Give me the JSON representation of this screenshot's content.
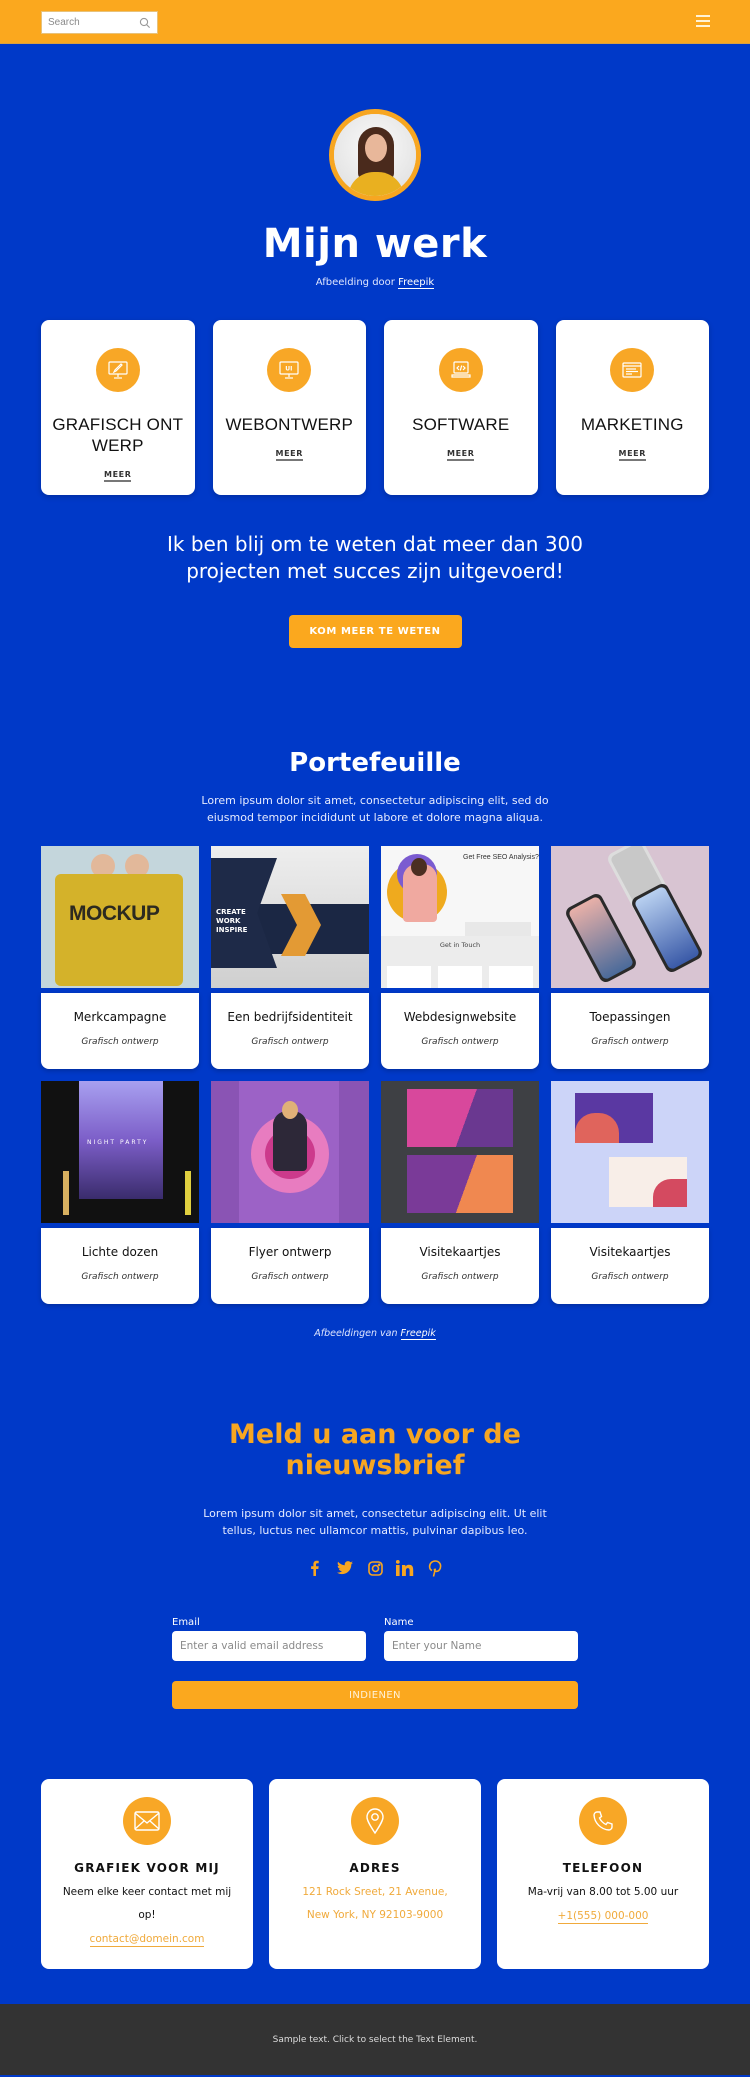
{
  "header": {
    "search_placeholder": "Search",
    "menu_icon": "hamburger-icon"
  },
  "hero": {
    "avatar_alt": "Portrait of smiling woman",
    "title": "Mijn werk",
    "credit_prefix": "Afbeelding door ",
    "credit_link": "Freepik"
  },
  "services": [
    {
      "icon": "graphic-design-monitor-icon",
      "title": "GRAFISCH ONTWERP",
      "link": "MEER"
    },
    {
      "icon": "ui-monitor-icon",
      "title": "WEBONTWERP",
      "link": "MEER"
    },
    {
      "icon": "code-laptop-icon",
      "title": "SOFTWARE",
      "link": "MEER"
    },
    {
      "icon": "browser-window-icon",
      "title": "MARKETING",
      "link": "MEER"
    }
  ],
  "tagline": "Ik ben blij om te weten dat meer dan 300 projecten met succes zijn uitgevoerd!",
  "cta_label": "KOM MEER TE WETEN",
  "portfolio": {
    "title": "Portefeuille",
    "lead": "Lorem ipsum dolor sit amet, consectetur adipiscing elit, sed do eiusmod tempor incididunt ut labore et dolore magna aliqua.",
    "items": [
      {
        "title": "Merkcampagne",
        "category": "Grafisch ontwerp",
        "image": "yellow mockup bag"
      },
      {
        "title": "Een bedrijfsidentiteit",
        "category": "Grafisch ontwerp",
        "image": "corporate template brochure"
      },
      {
        "title": "Webdesignwebsite",
        "category": "Grafisch ontwerp",
        "image": "SEO landing page"
      },
      {
        "title": "Toepassingen",
        "category": "Grafisch ontwerp",
        "image": "phone mockups"
      },
      {
        "title": "Lichte dozen",
        "category": "Grafisch ontwerp",
        "image": "night party lightbox poster"
      },
      {
        "title": "Flyer ontwerp",
        "category": "Grafisch ontwerp",
        "image": "purple flyer"
      },
      {
        "title": "Visitekaartjes",
        "category": "Grafisch ontwerp",
        "image": "pink purple business cards"
      },
      {
        "title": "Visitekaartjes",
        "category": "Grafisch ontwerp",
        "image": "pastel business cards"
      }
    ],
    "thumb_text": {
      "mockup": "MOCKUP",
      "create": "CREATE\nWORK\nINSPIRE",
      "seo": "Get Free SEO Analysis?",
      "touch": "Get in Touch",
      "party": "NIGHT PARTY"
    },
    "credit_prefix": "Afbeeldingen van ",
    "credit_link": "Freepik"
  },
  "newsletter": {
    "title": "Meld u aan voor de nieuwsbrief",
    "lead": "Lorem ipsum dolor sit amet, consectetur adipiscing elit. Ut elit tellus, luctus nec ullamcor mattis, pulvinar dapibus leo.",
    "social": [
      "facebook-icon",
      "twitter-icon",
      "instagram-icon",
      "linkedin-icon",
      "pinterest-icon"
    ],
    "email_label": "Email",
    "email_placeholder": "Enter a valid email address",
    "name_label": "Name",
    "name_placeholder": "Enter your Name",
    "submit_label": "INDIENEN"
  },
  "contacts": [
    {
      "icon": "envelope-icon",
      "title": "GRAFIEK VOOR MIJ",
      "text": "Neem elke keer contact met mij op!",
      "link": "contact@domein.com"
    },
    {
      "icon": "map-pin-icon",
      "title": "ADRES",
      "line1": "121 Rock Sreet, 21 Avenue,",
      "line2": "New York, NY 92103-9000"
    },
    {
      "icon": "phone-icon",
      "title": "TELEFOON",
      "text": "Ma-vrij van 8.00 tot 5.00 uur",
      "link": "+1(555) 000-000"
    }
  ],
  "footer": {
    "text": "Sample text. Click to select the Text Element."
  },
  "colors": {
    "primary_blue": "#0039c8",
    "accent_orange": "#fba81e",
    "footer_gray": "#333333",
    "card_white": "#ffffff"
  }
}
